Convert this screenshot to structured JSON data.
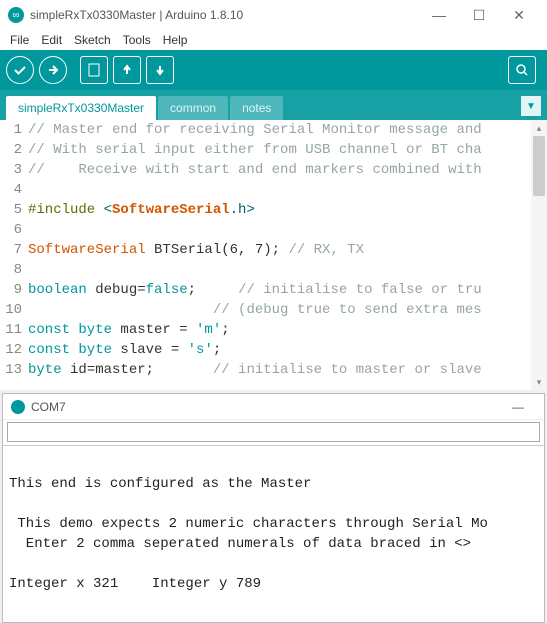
{
  "window": {
    "title": "simpleRxTx0330Master | Arduino 1.8.10"
  },
  "menu": {
    "file": "File",
    "edit": "Edit",
    "sketch": "Sketch",
    "tools": "Tools",
    "help": "Help"
  },
  "tabs": {
    "main": "simpleRxTx0330Master",
    "t1": "common",
    "t2": "notes"
  },
  "code": {
    "l1_num": "1",
    "l1": "// Master end for receiving Serial Monitor message and",
    "l2_num": "2",
    "l2": "// With serial input either from USB channel or BT cha",
    "l3_num": "3",
    "l3": "//    Receive with start and end markers combined with",
    "l4_num": "4",
    "l4": "",
    "l5_num": "5",
    "l5_pre": "#include ",
    "l5_lt": "<",
    "l5_lib": "SoftwareSerial",
    "l5_ext": ".h>",
    "l6_num": "6",
    "l7_num": "7",
    "l7_type": "SoftwareSerial",
    "l7_rest": " BTSerial(6, 7); ",
    "l7_cmt": "// RX, TX",
    "l8_num": "8",
    "l9_num": "9",
    "l9_type": "boolean",
    "l9_var": " debug=",
    "l9_val": "false",
    "l9_semi": ";     ",
    "l9_cmt": "// initialise to false or tru",
    "l10_num": "10",
    "l10_pad": "                      ",
    "l10_cmt": "// (debug true to send extra mes",
    "l11_num": "11",
    "l11_type": "const byte",
    "l11_var": " master = ",
    "l11_val": "'m'",
    "l11_semi": ";",
    "l12_num": "12",
    "l12_type": "const byte",
    "l12_var": " slave = ",
    "l12_val": "'s'",
    "l12_semi": ";",
    "l13_num": "13",
    "l13_type": "byte",
    "l13_var": " id=master;       ",
    "l13_cmt": "// initialise to master or slave"
  },
  "serial": {
    "title": "COM7",
    "out1": "This end is configured as the Master",
    "out2": "",
    "out3": " This demo expects 2 numeric characters through Serial Mo",
    "out4": "  Enter 2 comma seperated numerals of data braced in <>",
    "out5": "",
    "out6": "Integer x 321    Integer y 789"
  }
}
